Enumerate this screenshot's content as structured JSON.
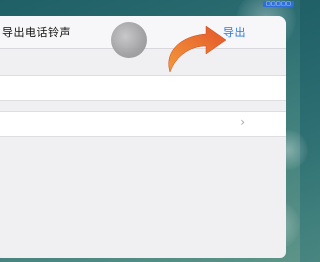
{
  "status_bar": {
    "label": "□□□□□"
  },
  "navbar": {
    "title": "导出电话铃声",
    "export_label": "导出"
  },
  "rows": [
    {
      "chevron": ""
    },
    {
      "chevron": "›"
    }
  ],
  "colors": {
    "accent": "#2d7be0",
    "arrow": "#e96a2b",
    "background": "#2c6e72"
  },
  "icons": {
    "touch_indicator": "touch-circle",
    "pointer_arrow": "curved-arrow-icon",
    "disclosure": "chevron-right-icon"
  }
}
